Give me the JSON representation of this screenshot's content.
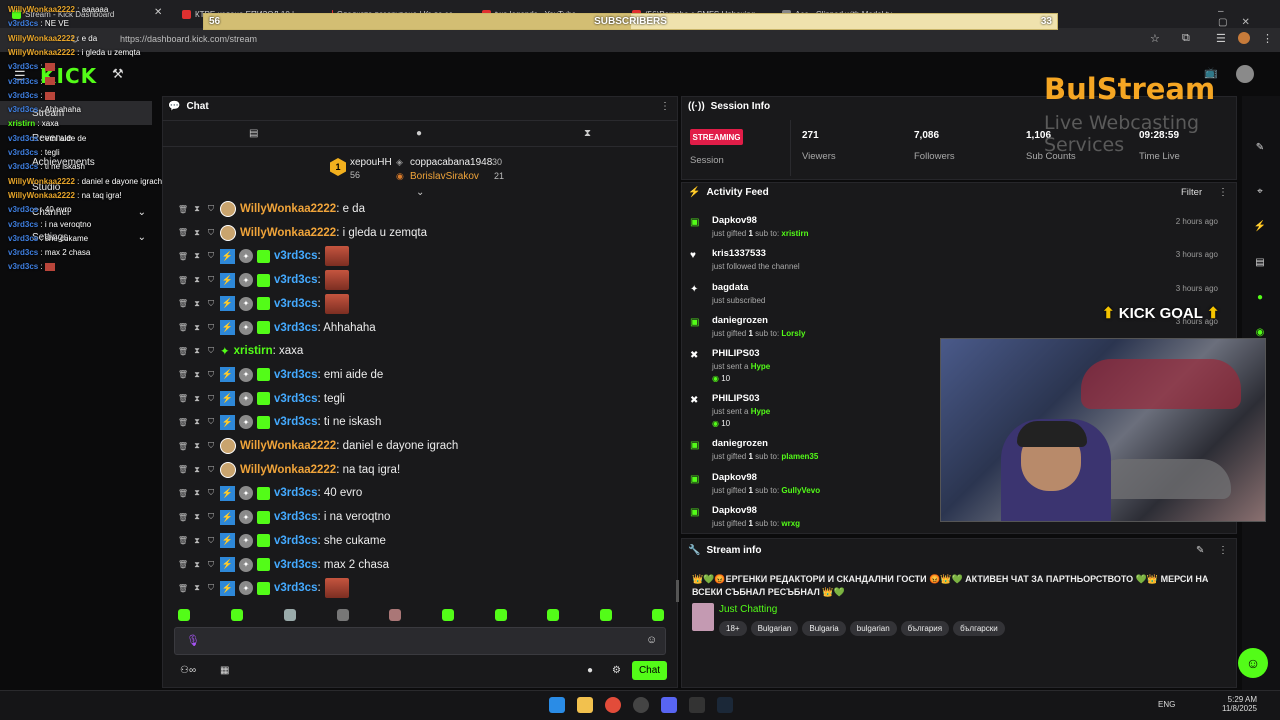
{
  "browser": {
    "tabs": [
      "Stream - Kick Dashboard",
      "КТРЕ изданa ЕПИЗОД 10 | ...",
      "Сладкото пазаруване | Къде се ...",
      "two legends - YouTube",
      "(56)Porsche с SMFS Unboxing",
      "Ace - Clipped with Medal.tv"
    ],
    "url": "https://dashboard.kick.com/stream"
  },
  "subscriber_goal": {
    "current": "56",
    "label": "SUBSCRIBERS",
    "target": "33",
    "fill_fraction": 0.5
  },
  "overlay_chat": [
    {
      "user": "WillyWonkaa2222",
      "color": "o",
      "text": "аааааа"
    },
    {
      "user": "v3rd3cs",
      "color": "b",
      "text": "NE VE"
    },
    {
      "user": "WillyWonkaa2222",
      "color": "o",
      "text": "e da"
    },
    {
      "user": "WillyWonkaa2222",
      "color": "o",
      "text": "i gleda u zemqta"
    },
    {
      "user": "v3rd3cs",
      "color": "b",
      "text": ""
    },
    {
      "user": "v3rd3cs",
      "color": "b",
      "text": ""
    },
    {
      "user": "v3rd3cs",
      "color": "b",
      "text": ""
    },
    {
      "user": "v3rd3cs",
      "color": "b",
      "text": "Ahhahaha"
    },
    {
      "user": "xristirn",
      "color": "g",
      "text": "xaxa"
    },
    {
      "user": "v3rd3cs",
      "color": "b",
      "text": "emi aide de"
    },
    {
      "user": "v3rd3cs",
      "color": "b",
      "text": "tegli"
    },
    {
      "user": "v3rd3cs",
      "color": "b",
      "text": "ti ne iskash"
    },
    {
      "user": "WillyWonkaa2222",
      "color": "o",
      "text": "daniel e dayone igrach"
    },
    {
      "user": "WillyWonkaa2222",
      "color": "o",
      "text": "na taq igra!"
    },
    {
      "user": "v3rd3cs",
      "color": "b",
      "text": "40 evro"
    },
    {
      "user": "v3rd3cs",
      "color": "b",
      "text": "i na veroqtno"
    },
    {
      "user": "v3rd3cs",
      "color": "b",
      "text": "she cukame"
    },
    {
      "user": "v3rd3cs",
      "color": "b",
      "text": "max 2 chasa"
    },
    {
      "user": "v3rd3cs",
      "color": "b",
      "text": ""
    }
  ],
  "sidebar": {
    "logo": "KICK",
    "items": [
      "Stream",
      "Revenue",
      "Achievements",
      "Studio",
      "Channel",
      "Settings"
    ]
  },
  "chat": {
    "title": "Chat",
    "top_gifters": [
      {
        "name": "xepouHH",
        "count": "56"
      },
      {
        "name": "coppacabana1948",
        "count": "30"
      },
      {
        "name": "BorislavSirakov",
        "count": "21"
      }
    ],
    "messages": [
      {
        "user": "WillyWonkaa2222",
        "kind": "o",
        "text": ": e da"
      },
      {
        "user": "WillyWonkaa2222",
        "kind": "o",
        "text": ": i gleda u zemqta"
      },
      {
        "user": "v3rd3cs",
        "kind": "b",
        "text": ":",
        "emote": true
      },
      {
        "user": "v3rd3cs",
        "kind": "b",
        "text": ":",
        "emote": true
      },
      {
        "user": "v3rd3cs",
        "kind": "b",
        "text": ":",
        "emote": true
      },
      {
        "user": "v3rd3cs",
        "kind": "b",
        "text": ": Ahhahaha"
      },
      {
        "user": "xristirn",
        "kind": "g",
        "text": ": xaxa"
      },
      {
        "user": "v3rd3cs",
        "kind": "b",
        "text": ": emi aide de"
      },
      {
        "user": "v3rd3cs",
        "kind": "b",
        "text": ": tegli"
      },
      {
        "user": "v3rd3cs",
        "kind": "b",
        "text": ": ti ne iskash"
      },
      {
        "user": "WillyWonkaa2222",
        "kind": "o",
        "text": ": daniel e dayone igrach"
      },
      {
        "user": "WillyWonkaa2222",
        "kind": "o",
        "text": ": na taq igra!"
      },
      {
        "user": "v3rd3cs",
        "kind": "b",
        "text": ": 40 evro"
      },
      {
        "user": "v3rd3cs",
        "kind": "b",
        "text": ": i na veroqtno"
      },
      {
        "user": "v3rd3cs",
        "kind": "b",
        "text": ": she cukame"
      },
      {
        "user": "v3rd3cs",
        "kind": "b",
        "text": ": max 2 chasa"
      },
      {
        "user": "v3rd3cs",
        "kind": "b",
        "text": ":",
        "emote": true
      }
    ],
    "send_label": "Chat"
  },
  "session": {
    "title": "Session Info",
    "status": "STREAMING",
    "status_label": "Session",
    "stats": [
      {
        "value": "271",
        "label": "Viewers"
      },
      {
        "value": "7,086",
        "label": "Followers"
      },
      {
        "value": "1,106",
        "label": "Sub Counts"
      },
      {
        "value": "09:28:59",
        "label": "Time Live"
      }
    ]
  },
  "activity": {
    "title": "Activity Feed",
    "filter_label": "Filter",
    "items": [
      {
        "who": "Dapkov98",
        "pre": "just gifted ",
        "n": "1",
        "mid": " sub to: ",
        "target": "xristirn",
        "time": "2 hours ago",
        "icon": "gift"
      },
      {
        "who": "kris1337533",
        "pre": "just followed the channel",
        "n": "",
        "mid": "",
        "target": "",
        "time": "3 hours ago",
        "icon": "heart"
      },
      {
        "who": "bagdata",
        "pre": "just subscribed",
        "n": "",
        "mid": "",
        "target": "",
        "time": "3 hours ago",
        "icon": "star"
      },
      {
        "who": "daniegrozen",
        "pre": "just gifted ",
        "n": "1",
        "mid": " sub to: ",
        "target": "Lorsly",
        "time": "3 hours ago",
        "icon": "gift"
      },
      {
        "who": "PHILIPS03",
        "pre": "just sent a ",
        "n": "",
        "mid": "",
        "target": "Hype",
        "time": "",
        "icon": "hype",
        "amount": "10"
      },
      {
        "who": "PHILIPS03",
        "pre": "just sent a ",
        "n": "",
        "mid": "",
        "target": "Hype",
        "time": "",
        "icon": "hype",
        "amount": "10"
      },
      {
        "who": "daniegrozen",
        "pre": "just gifted ",
        "n": "1",
        "mid": " sub to: ",
        "target": "plamen35",
        "time": "",
        "icon": "gift"
      },
      {
        "who": "Dapkov98",
        "pre": "just gifted ",
        "n": "1",
        "mid": " sub to: ",
        "target": "GullyVevo",
        "time": "",
        "icon": "gift"
      },
      {
        "who": "Dapkov98",
        "pre": "just gifted ",
        "n": "1",
        "mid": " sub to: ",
        "target": "wrxg",
        "time": "",
        "icon": "gift"
      }
    ]
  },
  "stream_info": {
    "title": "Stream info",
    "description": "👑💚😡ЕРГЕНКИ РЕДАКТОРИ И СКАНДАЛНИ ГОСТИ 😡👑💚 АКТИВЕН ЧАТ ЗА ПАРТНЬОРСТВОТО 💚👑 МЕРСИ НА ВСЕКИ СЪБНАЛ РЕСЪБНАЛ 👑💚",
    "category": "Just Chatting",
    "tags": [
      "18+",
      "Bulgarian",
      "Bulgaria",
      "bulgarian",
      "българия",
      "български"
    ]
  },
  "overlay": {
    "brand": "BulStream",
    "brand_sub": "Live Webcasting Services",
    "goal": "KICK GOAL"
  },
  "taskbar": {
    "lang": "ENG",
    "time": "5:29 AM",
    "date": "11/8/2025"
  },
  "colors": {
    "kick_green": "#53fc18",
    "streaming_red": "#e11d48",
    "brand_orange": "#f5a623"
  }
}
